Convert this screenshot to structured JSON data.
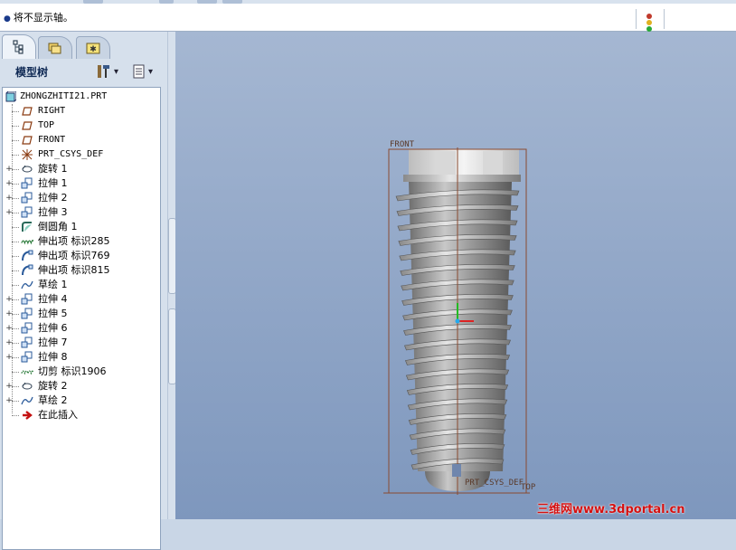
{
  "message_bar": {
    "text": "将不显示轴。"
  },
  "tabs": [
    {
      "icon": "model-tree-icon"
    },
    {
      "icon": "folder-browser-icon"
    },
    {
      "icon": "favorites-icon"
    }
  ],
  "tree_header": {
    "title": "模型树",
    "settings_icon": "tree-settings-icon",
    "show_icon": "tree-show-icon"
  },
  "tree": {
    "root": "ZHONGZHITI21.PRT",
    "items": [
      {
        "label": "RIGHT",
        "icon": "datum-plane-icon",
        "expandable": false
      },
      {
        "label": "TOP",
        "icon": "datum-plane-icon",
        "expandable": false
      },
      {
        "label": "FRONT",
        "icon": "datum-plane-icon",
        "expandable": false
      },
      {
        "label": "PRT_CSYS_DEF",
        "icon": "csys-icon",
        "expandable": false
      },
      {
        "label": "旋转 1",
        "icon": "revolve-icon",
        "expandable": true
      },
      {
        "label": "拉伸 1",
        "icon": "extrude-icon",
        "expandable": true
      },
      {
        "label": "拉伸 2",
        "icon": "extrude-icon",
        "expandable": true
      },
      {
        "label": "拉伸 3",
        "icon": "extrude-icon",
        "expandable": true
      },
      {
        "label": "倒圆角 1",
        "icon": "round-icon",
        "expandable": false
      },
      {
        "label": "伸出项 标识285",
        "icon": "helical-protrusion-icon",
        "expandable": false
      },
      {
        "label": "伸出项 标识769",
        "icon": "sweep-protrusion-icon",
        "expandable": false
      },
      {
        "label": "伸出项 标识815",
        "icon": "sweep-protrusion-icon",
        "expandable": false
      },
      {
        "label": "草绘 1",
        "icon": "sketch-icon",
        "expandable": false
      },
      {
        "label": "拉伸 4",
        "icon": "extrude-icon",
        "expandable": true
      },
      {
        "label": "拉伸 5",
        "icon": "extrude-icon",
        "expandable": true
      },
      {
        "label": "拉伸 6",
        "icon": "extrude-icon",
        "expandable": true
      },
      {
        "label": "拉伸 7",
        "icon": "extrude-icon",
        "expandable": true
      },
      {
        "label": "拉伸 8",
        "icon": "extrude-icon",
        "expandable": true
      },
      {
        "label": "切剪 标识1906",
        "icon": "helical-cut-icon",
        "expandable": false
      },
      {
        "label": "旋转 2",
        "icon": "revolve-icon",
        "expandable": true
      },
      {
        "label": "草绘 2",
        "icon": "sketch-icon",
        "expandable": true
      },
      {
        "label": "在此插入",
        "icon": "insert-here-arrow-icon",
        "expandable": false
      }
    ]
  },
  "viewport": {
    "datum_front": "FRONT",
    "datum_csys": "PRT_CSYS_DEF",
    "datum_top": "TOP",
    "background_top": "#a5b7d2",
    "background_bottom": "#7e97bd"
  },
  "watermark": "三维网www.3dportal.cn"
}
